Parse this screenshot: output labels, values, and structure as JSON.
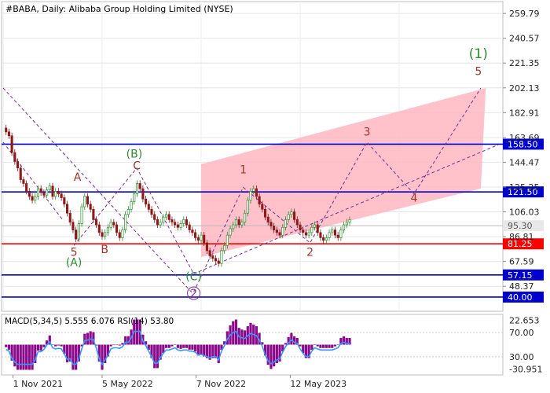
{
  "header": {
    "title": "#BABA, Daily:  Alibaba Group Holding Limited (NYSE)"
  },
  "indicator": {
    "title": "MACD(5,34,5) 5.555 6.076 RSI(14) 53.80"
  },
  "colors": {
    "up_candle": "#2e8b2e",
    "down_candle": "#8b1a1a",
    "channel": "#ffb6c1",
    "blue_level": "#0000cc",
    "red_level": "#ff0000",
    "wave_red": "#a0342a",
    "wave_green": "#2e8b2e",
    "wave_purple": "#7b2d8e",
    "macd_hist": "#8b0a8b",
    "signal": "#3399ff"
  },
  "chart_data": {
    "type": "candlestick",
    "symbol": "#BABA",
    "timeframe": "Daily",
    "price_axis_ticks": [
      "259.79",
      "240.57",
      "221.35",
      "202.13",
      "182.91",
      "163.69",
      "144.47",
      "125.25",
      "106.03",
      "86.81",
      "67.59",
      "48.37"
    ],
    "time_axis_labels": [
      "1 Nov 2021",
      "5 May 2022",
      "7 Nov 2022",
      "12 May 2023"
    ],
    "levels": [
      {
        "label": "158.50",
        "value": 158.5,
        "color": "blue"
      },
      {
        "label": "121.50",
        "value": 121.5,
        "color": "blue"
      },
      {
        "label": "81.25",
        "value": 81.25,
        "color": "red"
      },
      {
        "label": "57.15",
        "value": 57.15,
        "color": "blue"
      },
      {
        "label": "40.00",
        "value": 40.0,
        "color": "blue"
      }
    ],
    "current_price": {
      "label": "95.30",
      "value": 95.3
    },
    "wave_labels": [
      {
        "text": "(1)",
        "color": "green",
        "time": 0.96,
        "price": 225
      },
      {
        "text": "5",
        "color": "red",
        "time": 0.96,
        "price": 212
      },
      {
        "text": "3",
        "color": "red",
        "time": 0.735,
        "price": 165
      },
      {
        "text": "4",
        "color": "red",
        "time": 0.83,
        "price": 114
      },
      {
        "text": "1",
        "color": "red",
        "time": 0.485,
        "price": 136
      },
      {
        "text": "2",
        "color": "red",
        "time": 0.62,
        "price": 72
      },
      {
        "text": "A",
        "color": "red",
        "time": 0.15,
        "price": 130
      },
      {
        "text": "B",
        "color": "red",
        "time": 0.205,
        "price": 74
      },
      {
        "text": "C",
        "color": "red",
        "time": 0.27,
        "price": 139
      },
      {
        "text": "(B)",
        "color": "green",
        "time": 0.265,
        "price": 148
      },
      {
        "text": "5",
        "color": "red",
        "time": 0.143,
        "price": 72
      },
      {
        "text": "(A)",
        "color": "green",
        "time": 0.143,
        "price": 64
      },
      {
        "text": "(C)",
        "color": "green",
        "time": 0.385,
        "price": 53
      },
      {
        "text": "2",
        "color": "purple",
        "time": 0.385,
        "price": 40
      }
    ],
    "indicator": {
      "name": "MACD(5,34,5) / RSI(14)",
      "macd": 5.555,
      "signal": 6.076,
      "rsi": 53.8,
      "axis_ticks": [
        "22.653",
        "70.00",
        "30.00",
        "-30.951"
      ]
    },
    "price_series": [
      171,
      168,
      165,
      152,
      145,
      140,
      131,
      128,
      122,
      118,
      115,
      118,
      124,
      121,
      119,
      123,
      126,
      118,
      122,
      120,
      117,
      112,
      105,
      98,
      92,
      85,
      97,
      110,
      118,
      112,
      108,
      100,
      96,
      90,
      87,
      90,
      94,
      98,
      96,
      90,
      86,
      92,
      104,
      108,
      114,
      120,
      128,
      124,
      116,
      112,
      108,
      104,
      100,
      96,
      98,
      102,
      104,
      100,
      98,
      96,
      94,
      97,
      100,
      96,
      92,
      90,
      86,
      84,
      88,
      82,
      76,
      72,
      70,
      68,
      66,
      76,
      80,
      88,
      93,
      96,
      100,
      96,
      98,
      105,
      115,
      122,
      124,
      118,
      112,
      108,
      102,
      98,
      95,
      92,
      90,
      88,
      94,
      100,
      104,
      106,
      100,
      96,
      92,
      90,
      88,
      90,
      94,
      96,
      90,
      86,
      84,
      86,
      90,
      92,
      88,
      86,
      92,
      96,
      98,
      100
    ]
  }
}
